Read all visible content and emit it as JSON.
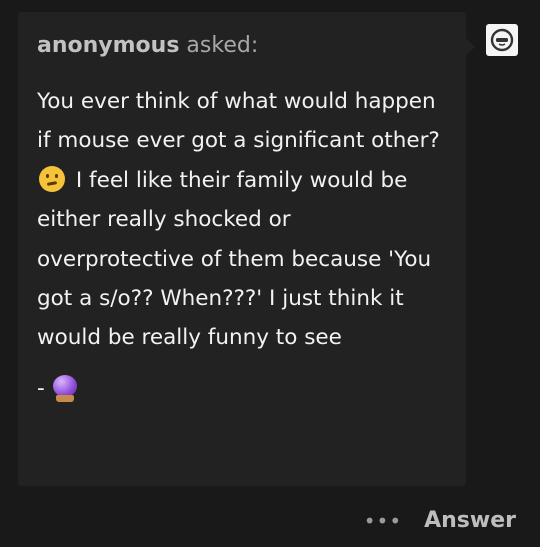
{
  "ask": {
    "asker_name": "anonymous",
    "asked_label": "asked:",
    "question_before_emoji": "You ever think of what would happen if mouse ever got a significant other?",
    "question_after_emoji": "I feel like their family would be either really shocked or overprotective of them because 'You got a s/o?? When???' I just think it would be really funny to see",
    "emoji_icon": "thinking-face-icon",
    "sign_off_dash": "-",
    "sign_off_icon": "crystal-ball-icon"
  },
  "actions": {
    "more_label": "•••",
    "answer_label": "Answer"
  },
  "colors": {
    "page_bg": "#191919",
    "card_bg": "#222222",
    "text": "#f2f2f2",
    "muted": "#a8a8a8"
  }
}
